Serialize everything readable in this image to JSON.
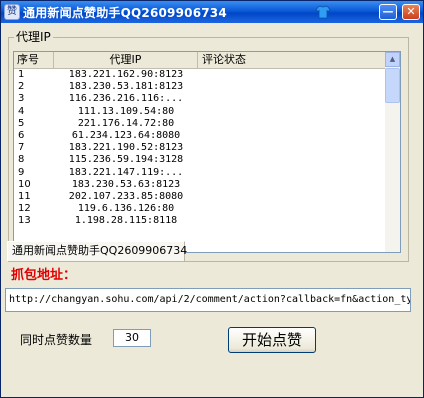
{
  "window": {
    "title": "通用新闻点赞助手QQ2609906734",
    "app_icon_glyph": "赞",
    "minimize_glyph": "—",
    "close_glyph": "✕"
  },
  "proxy_group": {
    "label": "代理IP",
    "columns": [
      "序号",
      "代理IP",
      "评论状态"
    ],
    "rows": [
      {
        "idx": "1",
        "ip": "183.221.162.90:8123",
        "status": ""
      },
      {
        "idx": "2",
        "ip": "183.230.53.181:8123",
        "status": ""
      },
      {
        "idx": "3",
        "ip": "116.236.216.116:...",
        "status": ""
      },
      {
        "idx": "4",
        "ip": "111.13.109.54:80",
        "status": ""
      },
      {
        "idx": "5",
        "ip": "221.176.14.72:80",
        "status": ""
      },
      {
        "idx": "6",
        "ip": "61.234.123.64:8080",
        "status": ""
      },
      {
        "idx": "7",
        "ip": "183.221.190.52:8123",
        "status": ""
      },
      {
        "idx": "8",
        "ip": "115.236.59.194:3128",
        "status": ""
      },
      {
        "idx": "9",
        "ip": "183.221.147.119:...",
        "status": ""
      },
      {
        "idx": "10",
        "ip": "183.230.53.63:8123",
        "status": ""
      },
      {
        "idx": "11",
        "ip": "202.107.233.85:8080",
        "status": ""
      },
      {
        "idx": "12",
        "ip": "119.6.136.126:80",
        "status": ""
      },
      {
        "idx": "13",
        "ip": "1.198.28.115:8118",
        "status": ""
      }
    ]
  },
  "status_bar": {
    "text": "通用新闻点赞助手QQ2609906734"
  },
  "capture": {
    "label": "抓包地址：",
    "url": "http://changyan.sohu.com/api/2/comment/action?callback=fn&action_ty"
  },
  "controls": {
    "count_label": "同时点赞数量",
    "count_value": "30",
    "start_label": "开始点赞"
  },
  "colors": {
    "title_bar": "#0a5ad8",
    "capture_label": "#e00000"
  }
}
